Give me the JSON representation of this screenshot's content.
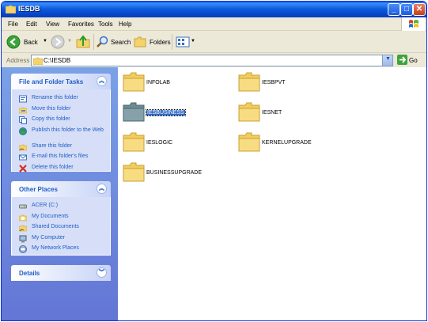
{
  "window": {
    "title": "IESDB"
  },
  "menu": [
    "File",
    "Edit",
    "View",
    "Favorites",
    "Tools",
    "Help"
  ],
  "toolbar": {
    "back_label": "Back",
    "search_label": "Search",
    "folders_label": "Folders"
  },
  "address": {
    "label": "Address",
    "value": "C:\\IESDB",
    "go_label": "Go"
  },
  "file_tasks": {
    "title": "File and Folder Tasks",
    "items": [
      {
        "label": "Rename this folder",
        "icon": "rename-icon"
      },
      {
        "label": "Move this folder",
        "icon": "move-icon"
      },
      {
        "label": "Copy this folder",
        "icon": "copy-icon"
      },
      {
        "label": "Publish this folder to the Web",
        "icon": "publish-web-icon"
      },
      {
        "label": "Share this folder",
        "icon": "share-icon"
      },
      {
        "label": "E-mail this folder's files",
        "icon": "email-icon"
      },
      {
        "label": "Delete this folder",
        "icon": "delete-icon"
      }
    ]
  },
  "other_places": {
    "title": "Other Places",
    "items": [
      {
        "label": "ACER (C:)",
        "icon": "drive-icon"
      },
      {
        "label": "My Documents",
        "icon": "my-documents-icon"
      },
      {
        "label": "Shared Documents",
        "icon": "shared-documents-icon"
      },
      {
        "label": "My Computer",
        "icon": "my-computer-icon"
      },
      {
        "label": "My Network Places",
        "icon": "network-places-icon"
      }
    ]
  },
  "details": {
    "title": "Details"
  },
  "folders": [
    {
      "name": "INFOLAB",
      "selected": false
    },
    {
      "name": "IESBPVT",
      "selected": false
    },
    {
      "name": "IESBUSINESS",
      "selected": true
    },
    {
      "name": "IESNET",
      "selected": false
    },
    {
      "name": "IESLOGIC",
      "selected": false
    },
    {
      "name": "KERNELUPGRADE",
      "selected": false
    },
    {
      "name": "BUSINESSUPGRADE",
      "selected": false
    }
  ],
  "colors": {
    "titlebar": "#0a5fe6",
    "taskpane": "#7aa1e6",
    "link": "#215dc6",
    "selection": "#316ac5"
  }
}
